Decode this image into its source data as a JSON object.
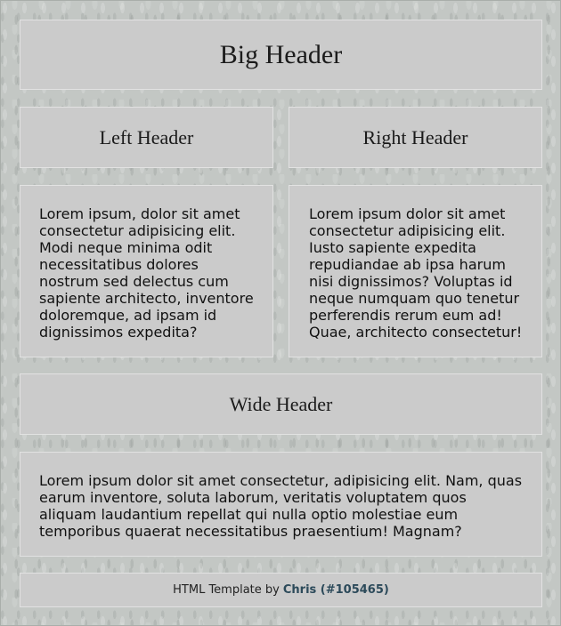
{
  "big_header": "Big Header",
  "left": {
    "header": "Left Header",
    "text": "Lorem ipsum, dolor sit amet consectetur adipisicing elit. Modi neque minima odit necessitatibus dolores nostrum sed delectus cum sapiente architecto, inventore doloremque, ad ipsam id dignissimos expedita?"
  },
  "right": {
    "header": "Right Header",
    "text": "Lorem ipsum dolor sit amet consectetur adipisicing elit. Iusto sapiente expedita repudiandae ab ipsa harum nisi dignissimos? Voluptas id neque numquam quo tenetur perferendis rerum eum ad! Quae, architecto consectetur!"
  },
  "wide": {
    "header": "Wide Header",
    "text": "Lorem ipsum dolor sit amet consectetur, adipisicing elit. Nam, quas earum inventore, soluta laborum, veritatis voluptatem quos aliquam laudantium repellat qui nulla optio molestiae eum temporibus quaerat necessitatibus praesentium! Magnam?"
  },
  "footer": {
    "prefix": "HTML Template by",
    "author": "Chris (#105465)"
  }
}
